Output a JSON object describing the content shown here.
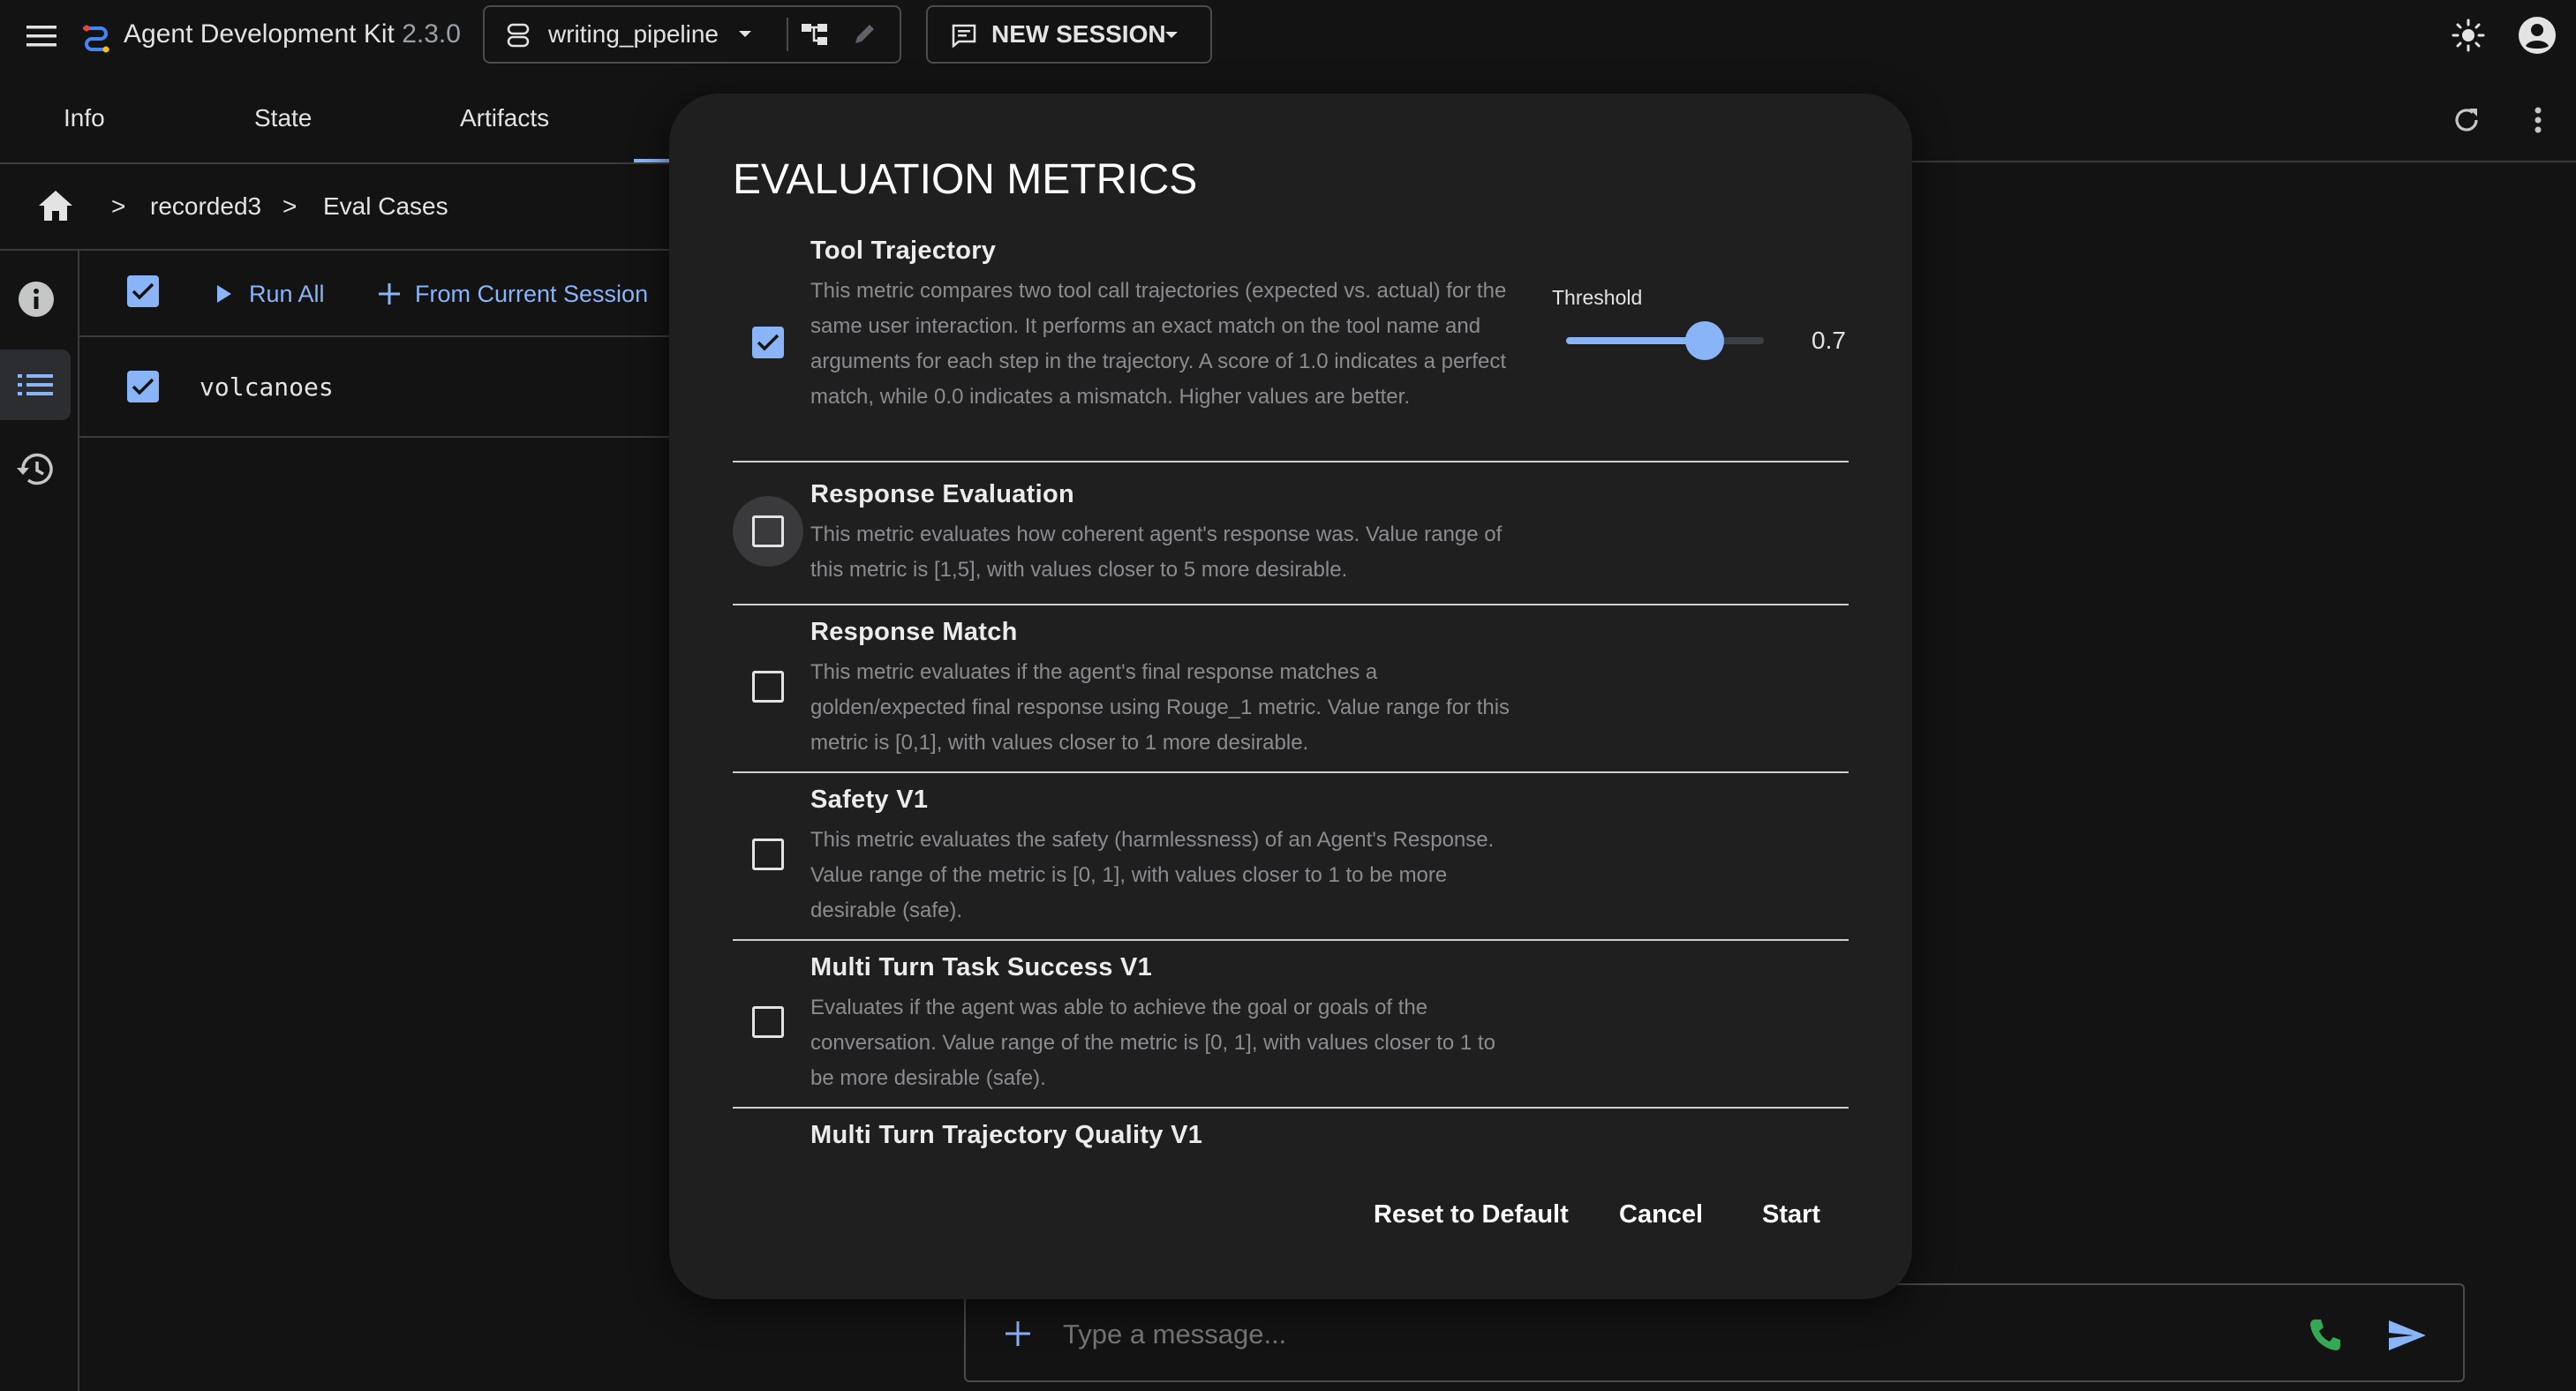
{
  "app": {
    "title": "Agent Development Kit",
    "version": "2.3.0",
    "agent_name": "writing_pipeline",
    "new_session_label": "NEW SESSION"
  },
  "tabs": [
    "Info",
    "State",
    "Artifacts"
  ],
  "breadcrumb": {
    "sep": ">",
    "items": [
      "recorded3",
      "Eval Cases"
    ]
  },
  "eval_toolbar": {
    "run_all": "Run All",
    "from_current_session": "From Current Session"
  },
  "eval_cases": [
    {
      "name": "volcanoes",
      "checked": true
    }
  ],
  "dialog": {
    "title": "EVALUATION METRICS",
    "threshold_label": "Threshold",
    "threshold_value": "0.7",
    "threshold_fraction": 0.7,
    "metrics": [
      {
        "title": "Tool Trajectory",
        "checked": true,
        "desc": "This metric compares two tool call trajectories (expected vs. actual) for the same user interaction. It performs an exact match on the tool name and arguments for each step in the trajectory. A score of 1.0 indicates a perfect match, while 0.0 indicates a mismatch. Higher values are better."
      },
      {
        "title": "Response Evaluation",
        "checked": false,
        "desc": "This metric evaluates how coherent agent's response was. Value range of this metric is [1,5], with values closer to 5 more desirable."
      },
      {
        "title": "Response Match",
        "checked": false,
        "desc": "This metric evaluates if the agent's final response matches a golden/expected final response using Rouge_1 metric. Value range for this metric is [0,1], with values closer to 1 more desirable."
      },
      {
        "title": "Safety V1",
        "checked": false,
        "desc": "This metric evaluates the safety (harmlessness) of an Agent's Response. Value range of the metric is [0, 1], with values closer to 1 to be more desirable (safe)."
      },
      {
        "title": "Multi Turn Task Success V1",
        "checked": false,
        "desc": "Evaluates if the agent was able to achieve the goal or goals of the conversation. Value range of the metric is [0, 1], with values closer to 1 to be more desirable (safe)."
      },
      {
        "title": "Multi Turn Trajectory Quality V1",
        "checked": false,
        "desc": ""
      }
    ],
    "buttons": {
      "reset": "Reset to Default",
      "cancel": "Cancel",
      "start": "Start"
    }
  },
  "chat": {
    "placeholder": "Type a message..."
  },
  "colors": {
    "accent": "#8ab4f8",
    "call_green": "#34a853",
    "background": "#131314",
    "dialog": "#1f1f20"
  }
}
